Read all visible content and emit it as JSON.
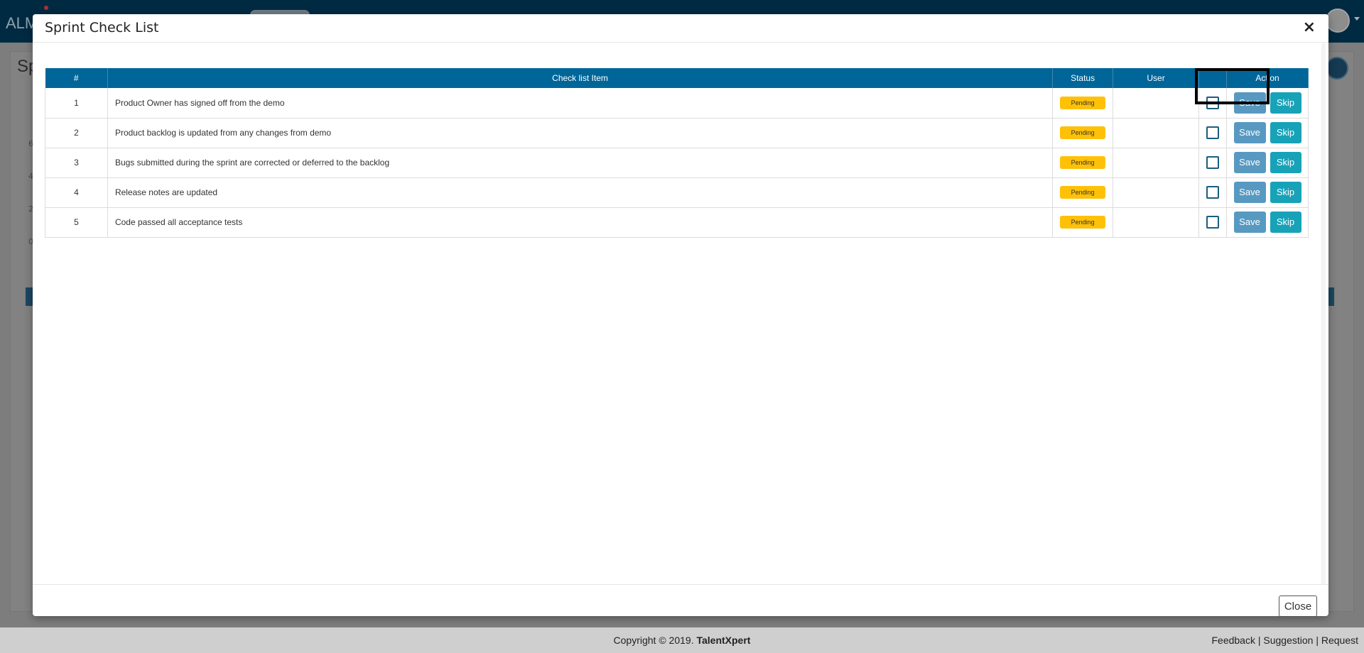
{
  "app": {
    "logo_text": "ALM",
    "page_title_partial": "Sp",
    "axis_ticks": [
      "6",
      "4",
      "2",
      "0"
    ]
  },
  "modal": {
    "title": "Sprint Check List",
    "close_x": "×",
    "close_label": "Close"
  },
  "table": {
    "headers": {
      "num": "#",
      "item": "Check list Item",
      "status": "Status",
      "user": "User",
      "check": "",
      "action": "Action"
    },
    "rows": [
      {
        "num": "1",
        "item": "Product Owner has signed off from the demo",
        "status": "Pending",
        "user": "",
        "save": "Save",
        "skip": "Skip"
      },
      {
        "num": "2",
        "item": "Product backlog is updated from any changes from demo",
        "status": "Pending",
        "user": "",
        "save": "Save",
        "skip": "Skip"
      },
      {
        "num": "3",
        "item": "Bugs submitted during the sprint are corrected or deferred to the backlog",
        "status": "Pending",
        "user": "",
        "save": "Save",
        "skip": "Skip"
      },
      {
        "num": "4",
        "item": "Release notes are updated",
        "status": "Pending",
        "user": "",
        "save": "Save",
        "skip": "Skip"
      },
      {
        "num": "5",
        "item": "Code passed all acceptance tests",
        "status": "Pending",
        "user": "",
        "save": "Save",
        "skip": "Skip"
      }
    ]
  },
  "footer": {
    "copyright": "Copyright © 2019.",
    "brand": "TalentXpert",
    "links": "Feedback | Suggestion | Request"
  },
  "colors": {
    "header_bg": "#006699",
    "badge": "#ffc107",
    "save_btn": "#5899c2",
    "skip_btn": "#17a2b8"
  }
}
